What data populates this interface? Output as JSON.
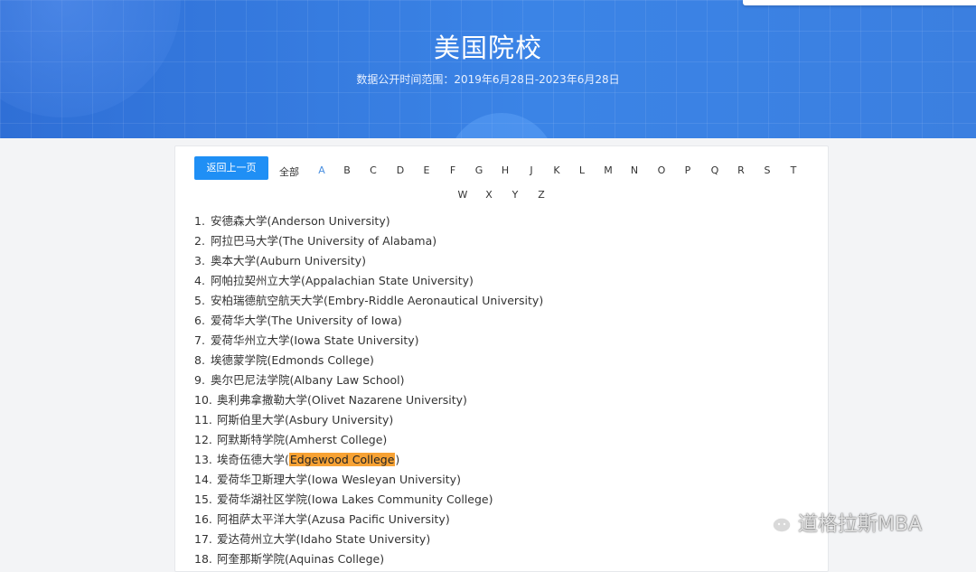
{
  "header": {
    "title": "美国院校",
    "subtitle": "数据公开时间范围：2019年6月28日-2023年6月28日"
  },
  "nav": {
    "back_label": "返回上一页",
    "all_label": "全部",
    "active_letter": "A",
    "letters": [
      "A",
      "B",
      "C",
      "D",
      "E",
      "F",
      "G",
      "H",
      "J",
      "K",
      "L",
      "M",
      "N",
      "O",
      "P",
      "Q",
      "R",
      "S",
      "T",
      "W",
      "X",
      "Y",
      "Z"
    ]
  },
  "schools": [
    {
      "num": "1.",
      "name": "安德森大学(Anderson University)"
    },
    {
      "num": "2.",
      "name": "阿拉巴马大学(The University of Alabama)"
    },
    {
      "num": "3.",
      "name": "奥本大学(Auburn University)"
    },
    {
      "num": "4.",
      "name": "阿帕拉契州立大学(Appalachian State University)"
    },
    {
      "num": "5.",
      "name": "安柏瑞德航空航天大学(Embry-Riddle Aeronautical University)"
    },
    {
      "num": "6.",
      "name": "爱荷华大学(The University of Iowa)"
    },
    {
      "num": "7.",
      "name": "爱荷华州立大学(Iowa State University)"
    },
    {
      "num": "8.",
      "name": "埃德蒙学院(Edmonds College)"
    },
    {
      "num": "9.",
      "name": "奥尔巴尼法学院(Albany Law School)"
    },
    {
      "num": "10.",
      "name": "奥利弗拿撒勒大学(Olivet Nazarene University)"
    },
    {
      "num": "11.",
      "name": "阿斯伯里大学(Asbury University)"
    },
    {
      "num": "12.",
      "name": "阿默斯特学院(Amherst College)"
    },
    {
      "num": "13.",
      "name_prefix": "埃奇伍德大学(",
      "name_highlight": "Edgewood College",
      "name_suffix": ")"
    },
    {
      "num": "14.",
      "name": "爱荷华卫斯理大学(Iowa Wesleyan University)"
    },
    {
      "num": "15.",
      "name": "爱荷华湖社区学院(Iowa Lakes Community College)"
    },
    {
      "num": "16.",
      "name": "阿祖萨太平洋大学(Azusa Pacific University)"
    },
    {
      "num": "17.",
      "name": "爱达荷州立大学(Idaho State University)"
    },
    {
      "num": "18.",
      "name": "阿奎那斯学院(Aquinas College)"
    }
  ],
  "watermark": {
    "text": "道格拉斯MBA",
    "icon": "wechat-icon"
  },
  "colors": {
    "accent": "#1f8ff5",
    "highlight": "#f7a234",
    "active_letter": "#4a8fe0"
  }
}
